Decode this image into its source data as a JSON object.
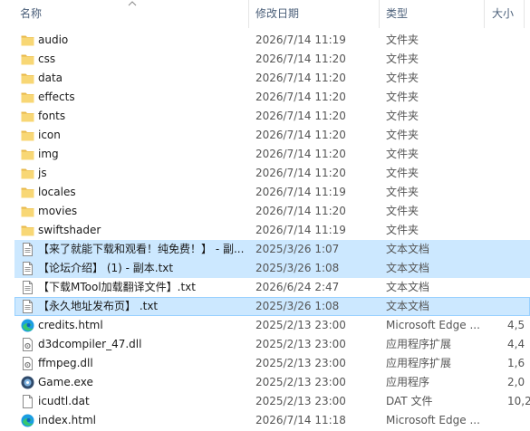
{
  "columns": {
    "name": "名称",
    "date": "修改日期",
    "type": "类型",
    "size": "大小"
  },
  "rows": [
    {
      "name": "audio",
      "date": "2026/7/14 11:19",
      "type": "文件夹",
      "size": "",
      "icon": "folder-icon",
      "selected": false
    },
    {
      "name": "css",
      "date": "2026/7/14 11:20",
      "type": "文件夹",
      "size": "",
      "icon": "folder-icon",
      "selected": false
    },
    {
      "name": "data",
      "date": "2026/7/14 11:20",
      "type": "文件夹",
      "size": "",
      "icon": "folder-icon",
      "selected": false
    },
    {
      "name": "effects",
      "date": "2026/7/14 11:20",
      "type": "文件夹",
      "size": "",
      "icon": "folder-icon",
      "selected": false
    },
    {
      "name": "fonts",
      "date": "2026/7/14 11:20",
      "type": "文件夹",
      "size": "",
      "icon": "folder-icon",
      "selected": false
    },
    {
      "name": "icon",
      "date": "2026/7/14 11:20",
      "type": "文件夹",
      "size": "",
      "icon": "folder-icon",
      "selected": false
    },
    {
      "name": "img",
      "date": "2026/7/14 11:20",
      "type": "文件夹",
      "size": "",
      "icon": "folder-icon",
      "selected": false
    },
    {
      "name": "js",
      "date": "2026/7/14 11:20",
      "type": "文件夹",
      "size": "",
      "icon": "folder-icon",
      "selected": false
    },
    {
      "name": "locales",
      "date": "2026/7/14 11:19",
      "type": "文件夹",
      "size": "",
      "icon": "folder-icon",
      "selected": false
    },
    {
      "name": "movies",
      "date": "2026/7/14 11:20",
      "type": "文件夹",
      "size": "",
      "icon": "folder-icon",
      "selected": false
    },
    {
      "name": "swiftshader",
      "date": "2026/7/14 11:19",
      "type": "文件夹",
      "size": "",
      "icon": "folder-icon",
      "selected": false
    },
    {
      "name": "【来了就能下载和观看！纯免费！】 - 副...",
      "date": "2025/3/26 1:07",
      "type": "文本文档",
      "size": "",
      "icon": "text-file-icon",
      "selected": true
    },
    {
      "name": "【论坛介绍】 (1) - 副本.txt",
      "date": "2025/3/26 1:08",
      "type": "文本文档",
      "size": "",
      "icon": "text-file-icon",
      "selected": true
    },
    {
      "name": "【下载MTool加载翻译文件】.txt",
      "date": "2026/6/24 2:47",
      "type": "文本文档",
      "size": "",
      "icon": "text-file-icon",
      "selected": false
    },
    {
      "name": "【永久地址发布页】 .txt",
      "date": "2025/3/26 1:08",
      "type": "文本文档",
      "size": "",
      "icon": "text-file-icon",
      "selected": true,
      "focused": true
    },
    {
      "name": "credits.html",
      "date": "2025/2/13 23:00",
      "type": "Microsoft Edge ...",
      "size": "4,5",
      "icon": "edge-icon",
      "selected": false
    },
    {
      "name": "d3dcompiler_47.dll",
      "date": "2025/2/13 23:00",
      "type": "应用程序扩展",
      "size": "4,4",
      "icon": "dll-file-icon",
      "selected": false
    },
    {
      "name": "ffmpeg.dll",
      "date": "2025/2/13 23:00",
      "type": "应用程序扩展",
      "size": "1,6",
      "icon": "dll-file-icon",
      "selected": false
    },
    {
      "name": "Game.exe",
      "date": "2025/2/13 23:00",
      "type": "应用程序",
      "size": "2,0",
      "icon": "exe-icon",
      "selected": false
    },
    {
      "name": "icudtl.dat",
      "date": "2025/2/13 23:00",
      "type": "DAT 文件",
      "size": "10,2",
      "icon": "file-icon",
      "selected": false
    },
    {
      "name": "index.html",
      "date": "2026/7/14 11:18",
      "type": "Microsoft Edge ...",
      "size": "",
      "icon": "edge-icon",
      "selected": false
    }
  ],
  "colors": {
    "selection": "#cce8ff",
    "focus_border": "#99d1ff",
    "folder": "#f8d775",
    "header_text": "#4c607a"
  }
}
